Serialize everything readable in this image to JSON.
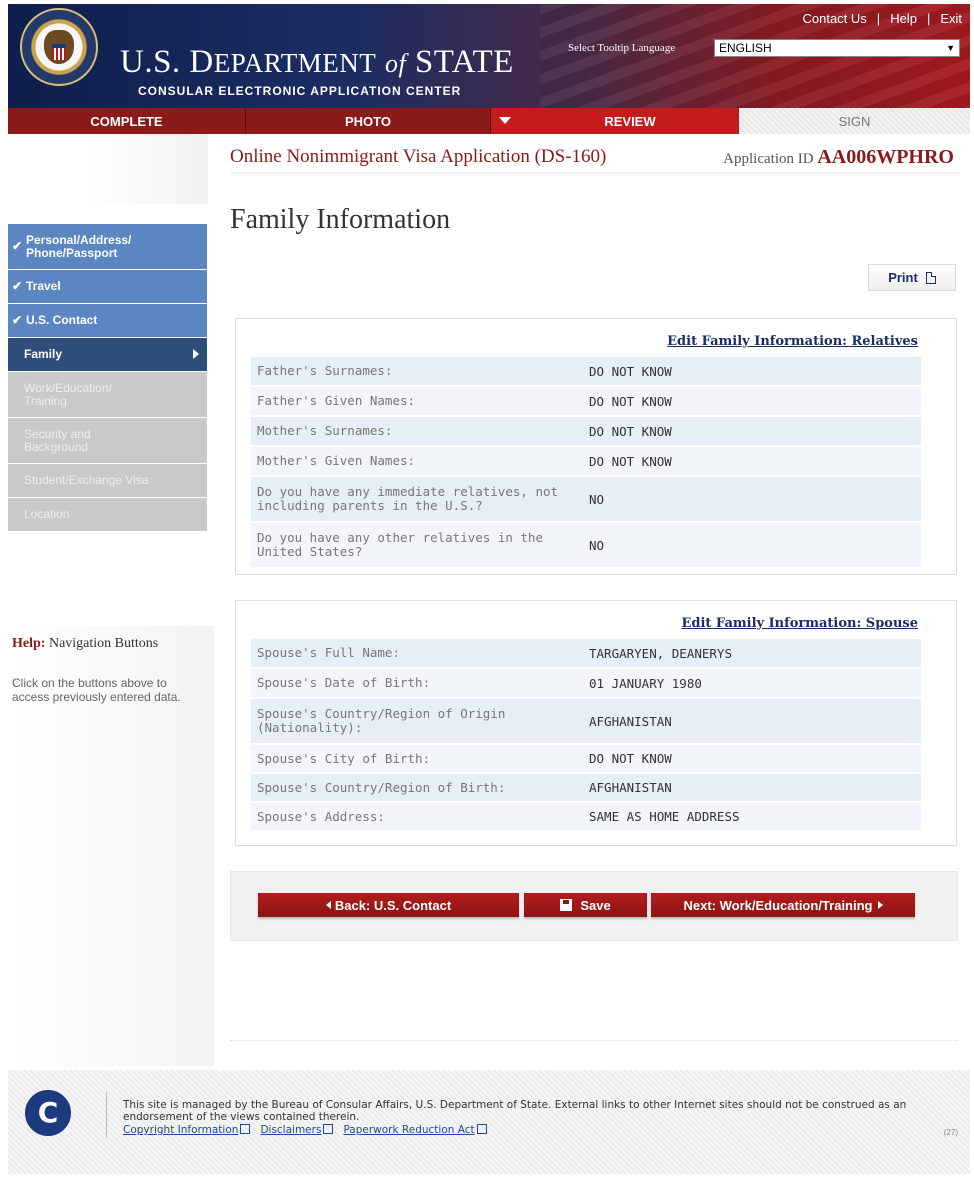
{
  "header": {
    "dept_title_main": "U.S. D",
    "dept_title_rest": "EPARTMENT",
    "dept_title_of": "of",
    "dept_title_state": "STATE",
    "subtitle": "CONSULAR ELECTRONIC APPLICATION CENTER",
    "links": [
      "Contact Us",
      "Help",
      "Exit"
    ],
    "lang_label": "Select Tooltip Language",
    "lang_value": "ENGLISH"
  },
  "steps": [
    "COMPLETE",
    "PHOTO",
    "REVIEW",
    "SIGN"
  ],
  "app": {
    "title": "Online Nonimmigrant Visa Application (DS-160)",
    "id_label": "Application ID",
    "id_value": "AA006WPHRO"
  },
  "page_title": "Family Information",
  "print_label": "Print",
  "sidebar": {
    "items": [
      {
        "label": "Personal/Address/ Phone/Passport",
        "state": "done"
      },
      {
        "label": "Travel",
        "state": "done"
      },
      {
        "label": "U.S. Contact",
        "state": "done"
      },
      {
        "label": "Family",
        "state": "active"
      },
      {
        "label": "Work/Education/ Training",
        "state": "todo"
      },
      {
        "label": "Security and Background",
        "state": "todo"
      },
      {
        "label": "Student/Exchange Visa",
        "state": "todo"
      },
      {
        "label": "Location",
        "state": "todo"
      }
    ],
    "help_title_prefix": "Help:",
    "help_title": "Navigation Buttons",
    "help_text": "Click on the buttons above to access previously entered data."
  },
  "relatives": {
    "edit_label": "Edit Family Information: Relatives",
    "rows": [
      {
        "label": "Father's Surnames:",
        "value": "DO NOT KNOW"
      },
      {
        "label": "Father's Given Names:",
        "value": "DO NOT KNOW"
      },
      {
        "label": "Mother's Surnames:",
        "value": "DO NOT KNOW"
      },
      {
        "label": "Mother's Given Names:",
        "value": "DO NOT KNOW"
      },
      {
        "label": "Do you have any immediate relatives, not including parents in the U.S.?",
        "value": "NO"
      },
      {
        "label": "Do you have any other relatives in the United States?",
        "value": "NO"
      }
    ]
  },
  "spouse": {
    "edit_label": "Edit Family Information: Spouse",
    "rows": [
      {
        "label": "Spouse's Full Name:",
        "value": "TARGARYEN, DEANERYS"
      },
      {
        "label": "Spouse's Date of Birth:",
        "value": "01 JANUARY 1980"
      },
      {
        "label": "Spouse's Country/Region of Origin (Nationality):",
        "value": "AFGHANISTAN"
      },
      {
        "label": "Spouse's City of Birth:",
        "value": "DO NOT KNOW"
      },
      {
        "label": "Spouse's Country/Region of Birth:",
        "value": "AFGHANISTAN"
      },
      {
        "label": "Spouse's Address:",
        "value": "SAME AS HOME ADDRESS"
      }
    ]
  },
  "buttons": {
    "back": "Back: U.S. Contact",
    "save": "Save",
    "next": "Next: Work/Education/Training"
  },
  "footer": {
    "text": "This site is managed by the Bureau of Consular Affairs, U.S. Department of State. External links to other Internet sites should not be construed as an endorsement of the views contained therein.",
    "links": [
      "Copyright Information",
      "Disclaimers",
      "Paperwork Reduction Act"
    ],
    "page_num": "(27)"
  },
  "colors": {
    "brand_red": "#8b1a1a",
    "active_step": "#c41c1c",
    "nav_done": "#5b86c2",
    "nav_active": "#2f4e7a",
    "nav_todo": "#c9c9c9",
    "link_blue": "#1b2d63"
  },
  "icons": {
    "seal": "dept-of-state-seal-icon",
    "print": "document-icon",
    "save": "floppy-disk-icon",
    "check": "checkmark-icon",
    "external": "external-link-icon",
    "footer_logo": "consular-affairs-logo-icon"
  }
}
